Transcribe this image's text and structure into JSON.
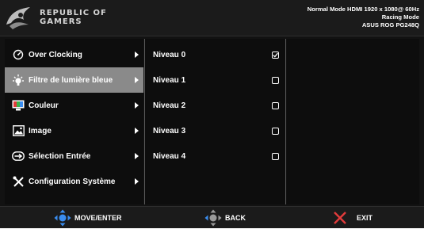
{
  "header": {
    "brand_line1": "REPUBLIC OF",
    "brand_line2": "GAMERS",
    "status_line1": "Normal Mode HDMI 1920 x 1080@ 60Hz",
    "status_line2": "Racing Mode",
    "status_line3": "ASUS ROG PG248Q"
  },
  "menu": {
    "items": [
      {
        "label": "Over Clocking",
        "icon": "speedometer-icon"
      },
      {
        "label": "Filtre de lumière bleue",
        "icon": "light-bulb-icon",
        "active": true
      },
      {
        "label": "Couleur",
        "icon": "color-monitor-icon"
      },
      {
        "label": "Image",
        "icon": "image-icon"
      },
      {
        "label": "Sélection Entrée",
        "icon": "input-select-icon"
      },
      {
        "label": "Configuration Système",
        "icon": "tools-icon"
      }
    ]
  },
  "submenu": {
    "items": [
      {
        "label": "Niveau 0",
        "checked": true
      },
      {
        "label": "Niveau 1",
        "checked": false
      },
      {
        "label": "Niveau 2",
        "checked": false
      },
      {
        "label": "Niveau 3",
        "checked": false
      },
      {
        "label": "Niveau 4",
        "checked": false
      }
    ]
  },
  "footer": {
    "move_label": "MOVE/ENTER",
    "back_label": "BACK",
    "exit_label": "EXIT"
  },
  "colors": {
    "accent_blue": "#3a8df0",
    "exit_red": "#e23b3b",
    "highlight": "#8a8a8a"
  }
}
